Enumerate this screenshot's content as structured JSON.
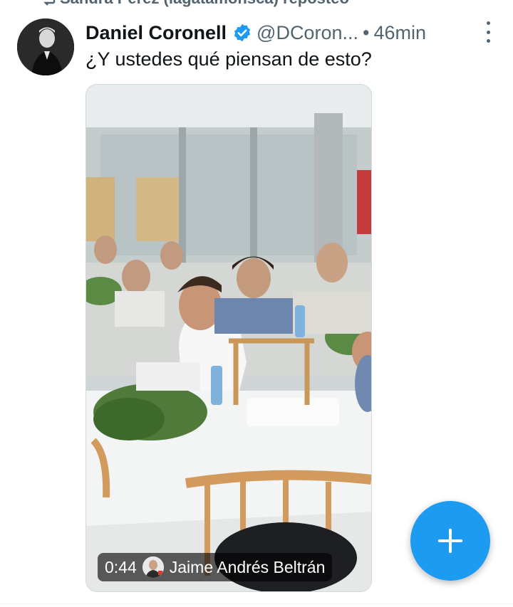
{
  "repost": {
    "text": "Sandra Pérez (lagatamonsca) reposteó",
    "icon": "repost-icon"
  },
  "tweet": {
    "author_name": "Daniel Coronell",
    "verified": true,
    "handle": "@DCoron...",
    "separator": "•",
    "time": "46min",
    "text": "¿Y ustedes qué piensan de esto?"
  },
  "media": {
    "type": "video",
    "duration": "0:44",
    "uploader": "Jaime Andrés Beltrán"
  },
  "colors": {
    "accent": "#1d9bf0",
    "secondary_text": "#536471",
    "primary_text": "#0f1419"
  },
  "fab": {
    "icon": "plus-icon"
  }
}
